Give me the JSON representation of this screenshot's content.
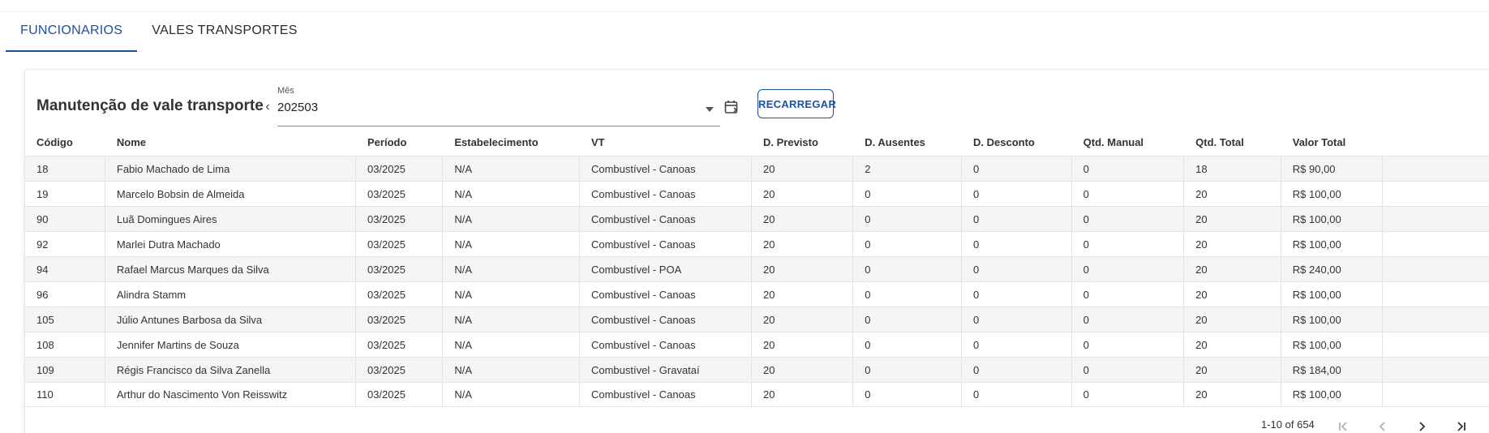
{
  "tabs": [
    {
      "label": "FUNCIONARIOS"
    },
    {
      "label": "VALES TRANSPORTES"
    }
  ],
  "accent_color": "#1f4fa0",
  "card": {
    "title": "Manutenção de vale transporte",
    "month_label": "Mês",
    "month_value": "202503",
    "reload_label": "RECARREGAR"
  },
  "table": {
    "columns": [
      "Código",
      "Nome",
      "Período",
      "Estabelecimento",
      "VT",
      "D. Previsto",
      "D. Ausentes",
      "D. Desconto",
      "Qtd. Manual",
      "Qtd. Total",
      "Valor Total",
      ""
    ],
    "rows": [
      [
        "18",
        "Fabio Machado de Lima",
        "03/2025",
        "N/A",
        "Combustível - Canoas",
        "20",
        "2",
        "0",
        "0",
        "18",
        "R$ 90,00",
        ""
      ],
      [
        "19",
        "Marcelo Bobsin de Almeida",
        "03/2025",
        "N/A",
        "Combustível - Canoas",
        "20",
        "0",
        "0",
        "0",
        "20",
        "R$ 100,00",
        ""
      ],
      [
        "90",
        "Luã Domingues Aires",
        "03/2025",
        "N/A",
        "Combustível - Canoas",
        "20",
        "0",
        "0",
        "0",
        "20",
        "R$ 100,00",
        ""
      ],
      [
        "92",
        "Marlei Dutra Machado",
        "03/2025",
        "N/A",
        "Combustível - Canoas",
        "20",
        "0",
        "0",
        "0",
        "20",
        "R$ 100,00",
        ""
      ],
      [
        "94",
        "Rafael Marcus Marques da Silva",
        "03/2025",
        "N/A",
        "Combustível - POA",
        "20",
        "0",
        "0",
        "0",
        "20",
        "R$ 240,00",
        ""
      ],
      [
        "96",
        "Alindra Stamm",
        "03/2025",
        "N/A",
        "Combustível - Canoas",
        "20",
        "0",
        "0",
        "0",
        "20",
        "R$ 100,00",
        ""
      ],
      [
        "105",
        "Júlio Antunes Barbosa da Silva",
        "03/2025",
        "N/A",
        "Combustível - Canoas",
        "20",
        "0",
        "0",
        "0",
        "20",
        "R$ 100,00",
        ""
      ],
      [
        "108",
        "Jennifer Martins de Souza",
        "03/2025",
        "N/A",
        "Combustível - Canoas",
        "20",
        "0",
        "0",
        "0",
        "20",
        "R$ 100,00",
        ""
      ],
      [
        "109",
        "Régis Francisco da Silva Zanella",
        "03/2025",
        "N/A",
        "Combustível - Gravataí",
        "20",
        "0",
        "0",
        "0",
        "20",
        "R$ 184,00",
        ""
      ],
      [
        "110",
        "Arthur do Nascimento Von Reisswitz",
        "03/2025",
        "N/A",
        "Combustível - Canoas",
        "20",
        "0",
        "0",
        "0",
        "20",
        "R$ 100,00",
        ""
      ]
    ]
  },
  "pagination": {
    "info": "1-10 of 654",
    "icons": [
      "first-page-icon",
      "previous-page-icon",
      "next-page-icon",
      "last-page-icon"
    ]
  }
}
